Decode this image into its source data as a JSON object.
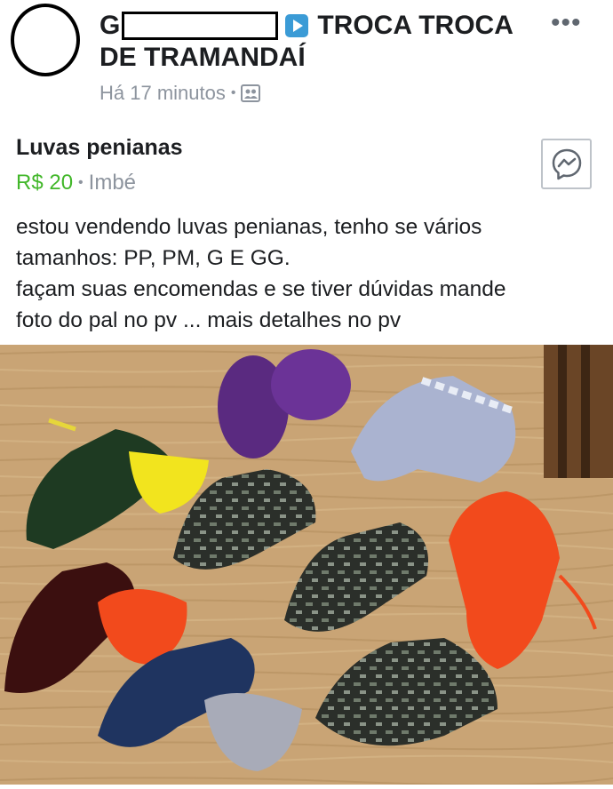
{
  "post": {
    "group_name_prefix": "G",
    "group_name_suffix": "TROCA TROCA",
    "group_name_line2": "DE TRAMANDAÍ",
    "timestamp": "Há 17 minutos",
    "meta_separator": "•"
  },
  "listing": {
    "title": "Luvas penianas",
    "price": "R$ 20",
    "separator": "•",
    "location": "Imbé"
  },
  "description": {
    "line1": "estou vendendo luvas penianas, tenho se vários",
    "line2": "tamanhos: PP, PM, G E GG.",
    "line3": "façam suas encomendas e se tiver dúvidas mande",
    "line4": "foto do pal no pv ... mais detalhes no pv"
  },
  "icons": {
    "more": "more-horizontal-icon",
    "messenger": "messenger-icon",
    "audience": "group-icon",
    "play": "play-icon"
  },
  "colors": {
    "price_green": "#42b72a",
    "meta_gray": "#8d949e",
    "play_blue": "#3b9bd6",
    "wood": "#c9a475"
  }
}
